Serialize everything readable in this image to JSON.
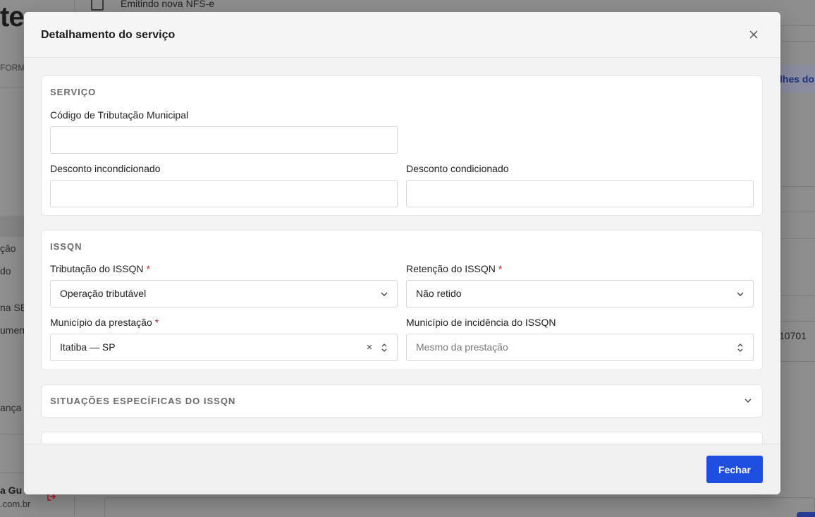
{
  "background": {
    "logo_text": "te",
    "sidebar_label": "FORM",
    "sidebar_items": [
      "ção",
      "do",
      "na SE",
      "umen",
      "ança"
    ],
    "user_name": "a Gu",
    "user_email": ".com.br",
    "topbar_title": "Emitindo nova NFS-e",
    "right_link": "lhes do",
    "right_number": "10701"
  },
  "modal": {
    "title": "Detalhamento do serviço",
    "close_icon": "close-icon",
    "footer": {
      "close_label": "Fechar"
    }
  },
  "servico": {
    "section_title": "SERVIÇO",
    "codigo_label": "Código de Tributação Municipal",
    "codigo_value": "",
    "desc_incond_label": "Desconto incondicionado",
    "desc_incond_value": "",
    "desc_cond_label": "Desconto condicionado",
    "desc_cond_value": ""
  },
  "issqn": {
    "section_title": "ISSQN",
    "tributacao_label": "Tributação do ISSQN",
    "tributacao_value": "Operação tributável",
    "retencao_label": "Retenção do ISSQN",
    "retencao_value": "Não retido",
    "municipio_prestacao_label": "Município da prestação",
    "municipio_prestacao_value": "Itatiba — SP",
    "municipio_incidencia_label": "Município de incidência do ISSQN",
    "municipio_incidencia_placeholder": "Mesmo da prestação",
    "required_mark": "*"
  },
  "situacoes": {
    "section_title": "SITUAÇÕES ESPECÍFICAS DO ISSQN"
  },
  "colors": {
    "primary": "#1f4fe0",
    "required": "#d61f1f",
    "section_title": "#6a6a6a"
  }
}
